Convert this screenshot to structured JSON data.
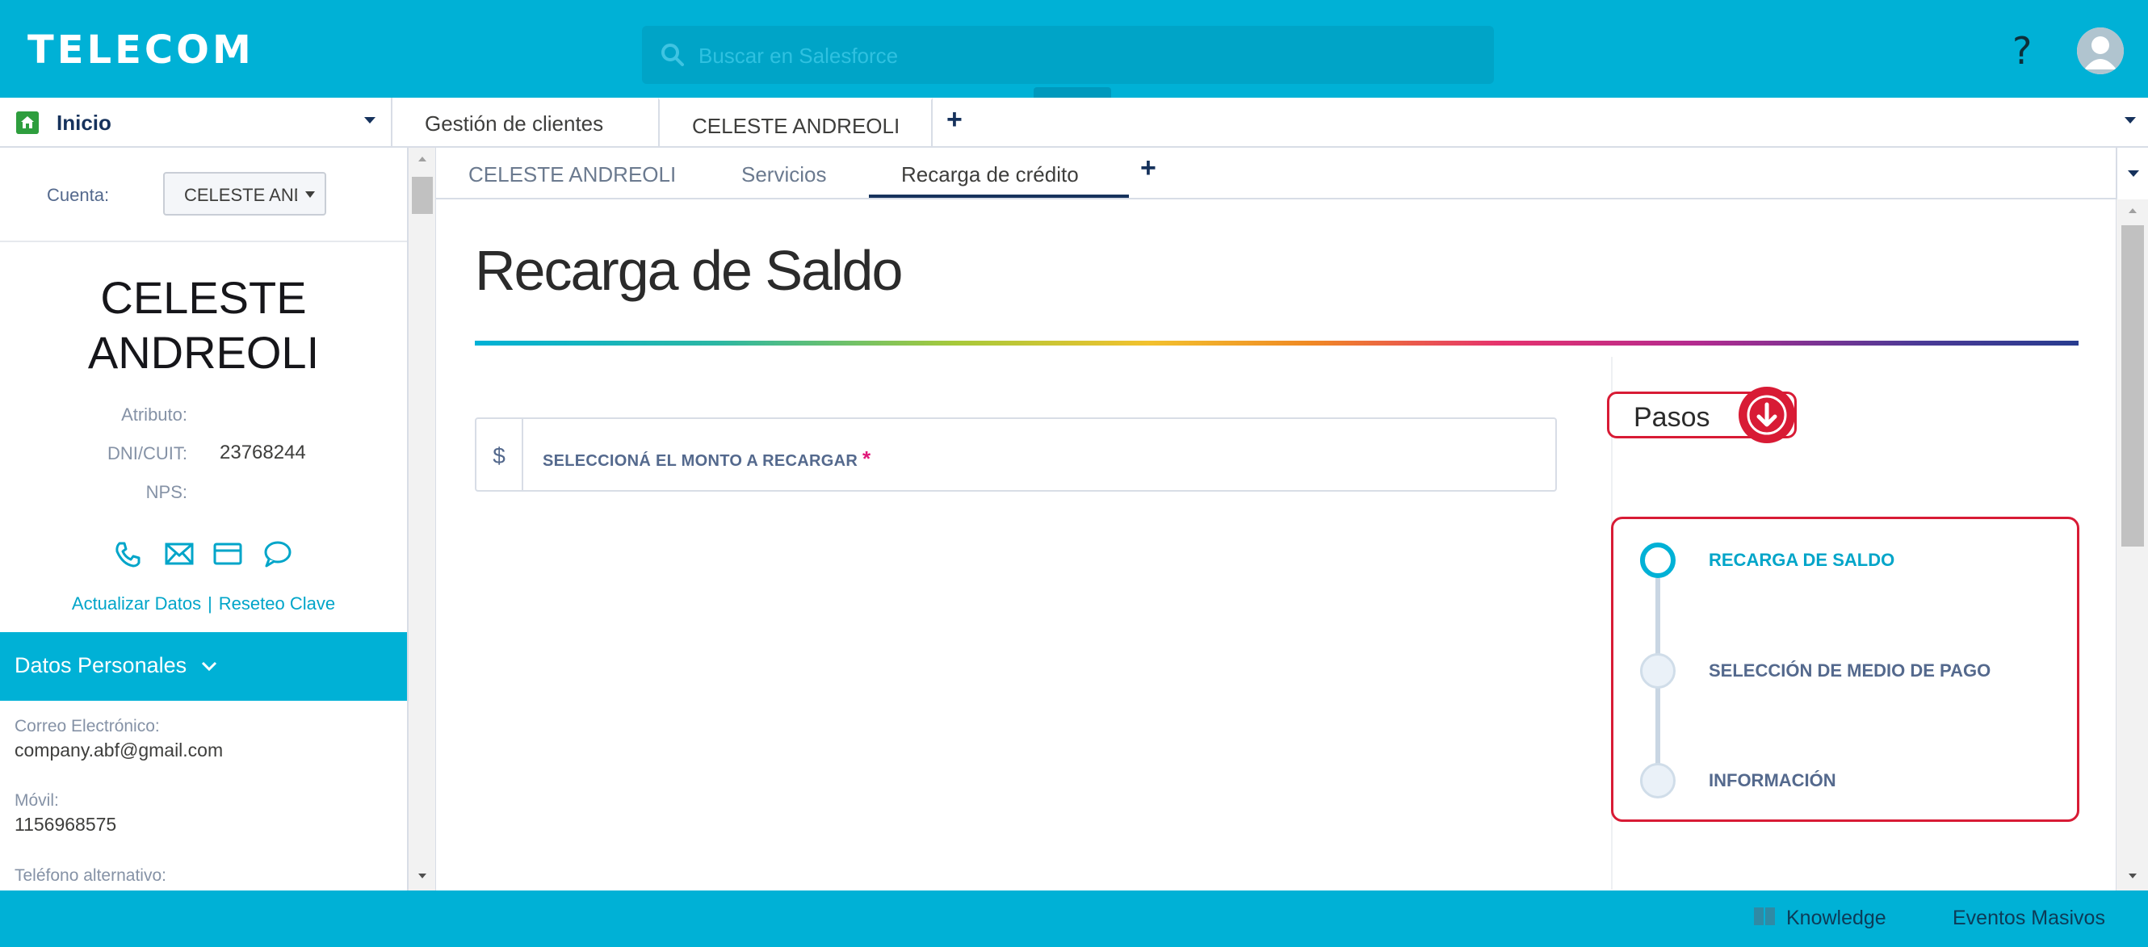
{
  "header": {
    "logo": "TELECOM",
    "search_placeholder": "Buscar en Salesforce",
    "help": "?"
  },
  "primary_tabs": {
    "home": "Inicio",
    "tabs": [
      {
        "label": "Gestión de clientes",
        "active": false
      },
      {
        "label": "CELESTE ANDREOLI",
        "active": true
      }
    ]
  },
  "account": {
    "label": "Cuenta:",
    "selected": "CELESTE ANDREOLI"
  },
  "customer": {
    "name_line1": "CELESTE",
    "name_line2": "ANDREOLI",
    "fields": [
      {
        "label": "Atributo:",
        "value": ""
      },
      {
        "label": "DNI/CUIT:",
        "value": "23768244"
      },
      {
        "label": "NPS:",
        "value": ""
      }
    ],
    "contact_icons": [
      "phone-icon",
      "email-icon",
      "card-icon",
      "chat-icon"
    ],
    "links": {
      "update": "Actualizar Datos",
      "separator": "|",
      "reset": "Reseteo Clave"
    }
  },
  "personal_data": {
    "title": "Datos Personales",
    "items": [
      {
        "label": "Correo Electrónico:",
        "value": "company.abf@gmail.com"
      },
      {
        "label": "Móvil:",
        "value": "1156968575"
      },
      {
        "label": "Teléfono alternativo:",
        "value": ""
      }
    ]
  },
  "sub_tabs": [
    {
      "label": "CELESTE ANDREOLI",
      "active": false
    },
    {
      "label": "Servicios",
      "active": false
    },
    {
      "label": "Recarga de crédito",
      "active": true
    }
  ],
  "main": {
    "title": "Recarga de Saldo",
    "amount": {
      "currency": "$",
      "label": "SELECCIONÁ EL MONTO A RECARGAR",
      "required_mark": "*"
    },
    "pasos_label": "Pasos",
    "steps": [
      {
        "label": "RECARGA DE SALDO",
        "active": true
      },
      {
        "label": "SELECCIÓN DE MEDIO DE PAGO",
        "active": false
      },
      {
        "label": "INFORMACIÓN",
        "active": false
      }
    ]
  },
  "footer": {
    "knowledge": "Knowledge",
    "eventos": "Eventos Masivos"
  },
  "colors": {
    "brand": "#00b1d6",
    "highlight_red": "#d81b35",
    "required_pink": "#e0187a"
  }
}
